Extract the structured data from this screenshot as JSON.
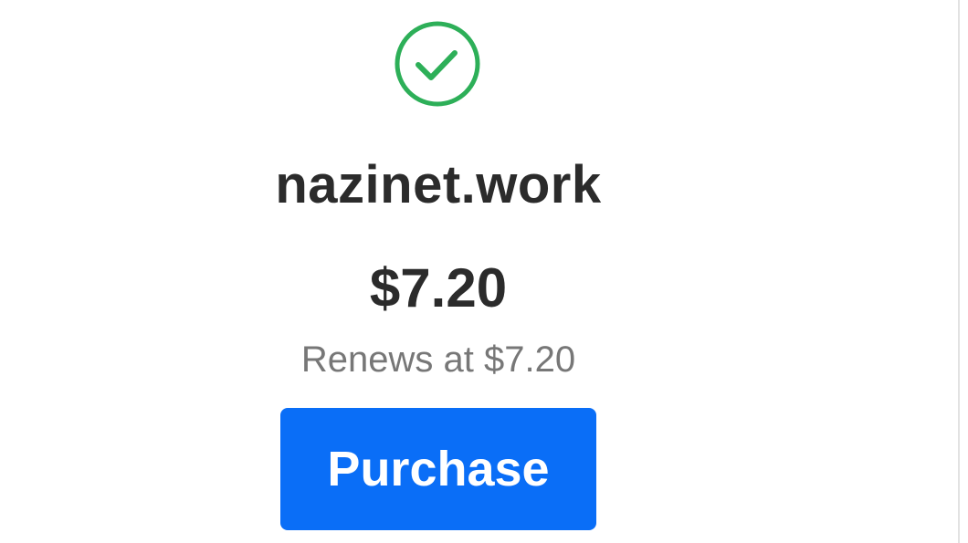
{
  "result": {
    "status_icon": "check-circle-icon",
    "status_color": "#2daf58",
    "domain": "nazinet.work",
    "price": "$7.20",
    "renewal_text": "Renews at $7.20"
  },
  "actions": {
    "purchase_label": "Purchase",
    "button_color": "#0a6ef7"
  }
}
